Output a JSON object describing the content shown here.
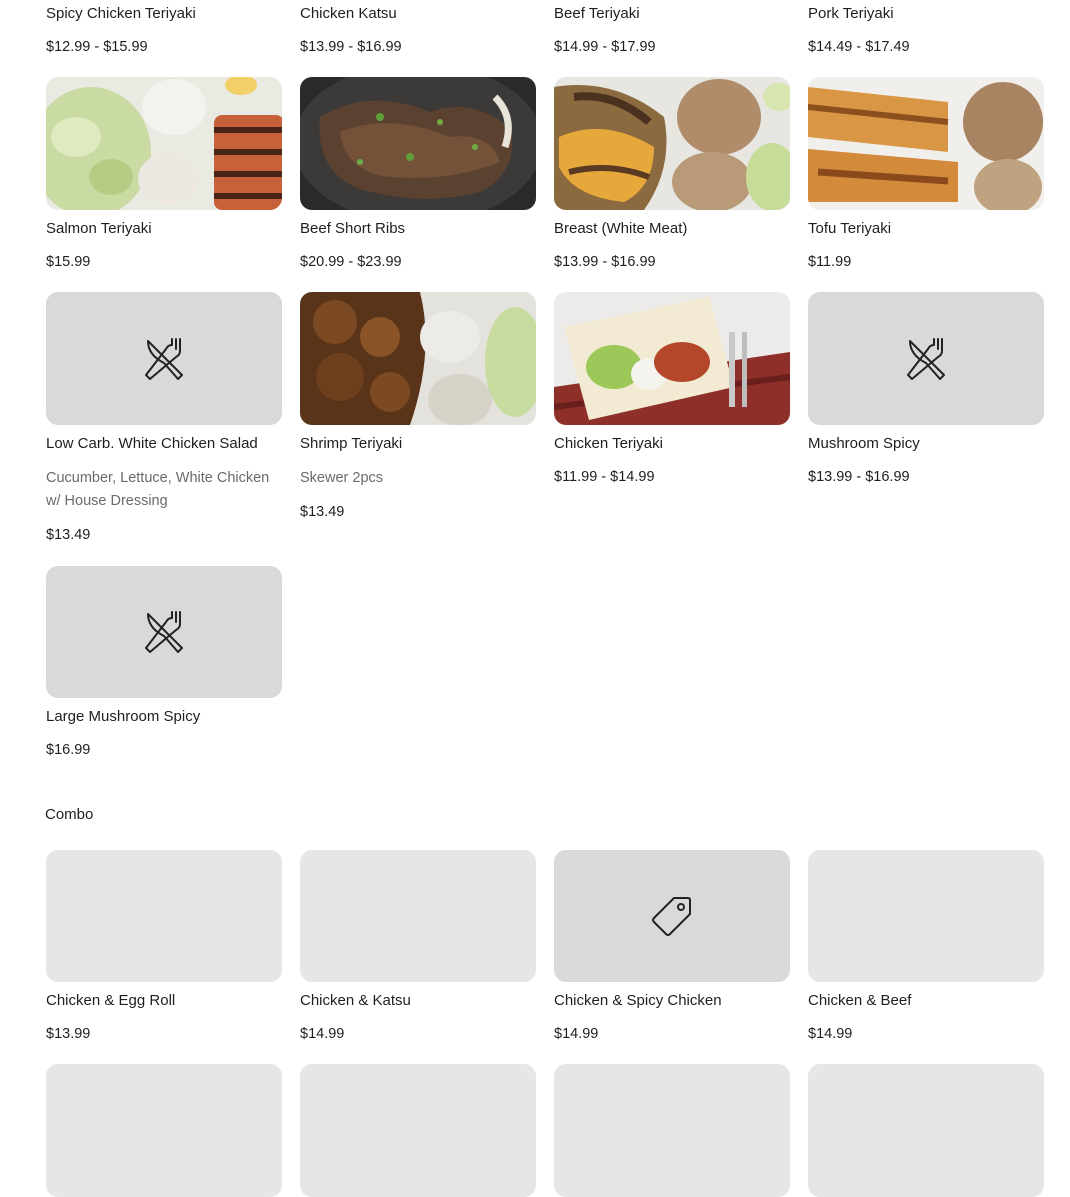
{
  "top_items": [
    {
      "name": "Spicy Chicken Teriyaki",
      "price": "$12.99 - $15.99"
    },
    {
      "name": "Chicken Katsu",
      "price": "$13.99 - $16.99"
    },
    {
      "name": "Beef Teriyaki",
      "price": "$14.99 - $17.99"
    },
    {
      "name": "Pork Teriyaki",
      "price": "$14.49 - $17.49"
    }
  ],
  "row2": [
    {
      "name": "Salmon Teriyaki",
      "price": "$15.99",
      "image": "photo"
    },
    {
      "name": "Beef Short Ribs",
      "price": "$20.99 - $23.99",
      "image": "photo"
    },
    {
      "name": "Breast (White Meat)",
      "price": "$13.99 - $16.99",
      "image": "photo"
    },
    {
      "name": "Tofu Teriyaki",
      "price": "$11.99",
      "image": "photo"
    }
  ],
  "row3": [
    {
      "name": "Low Carb. White Chicken Salad",
      "desc": "Cucumber, Lettuce, White Chicken w/ House Dressing",
      "price": "$13.49",
      "image": "utensils-icon"
    },
    {
      "name": "Shrimp Teriyaki",
      "desc": "Skewer 2pcs",
      "price": "$13.49",
      "image": "photo"
    },
    {
      "name": "Chicken Teriyaki",
      "price": "$11.99 - $14.99",
      "image": "photo"
    },
    {
      "name": "Mushroom Spicy",
      "price": "$13.99 - $16.99",
      "image": "utensils-icon"
    }
  ],
  "row4": [
    {
      "name": "Large Mushroom Spicy",
      "price": "$16.99",
      "image": "utensils-icon"
    }
  ],
  "combo": {
    "title": "Combo",
    "items": [
      {
        "name": "Chicken & Egg Roll",
        "price": "$13.99",
        "image": "blank"
      },
      {
        "name": "Chicken & Katsu",
        "price": "$14.99",
        "image": "blank"
      },
      {
        "name": "Chicken & Spicy Chicken",
        "price": "$14.99",
        "image": "tag-icon"
      },
      {
        "name": "Chicken & Beef",
        "price": "$14.99",
        "image": "blank"
      }
    ]
  }
}
